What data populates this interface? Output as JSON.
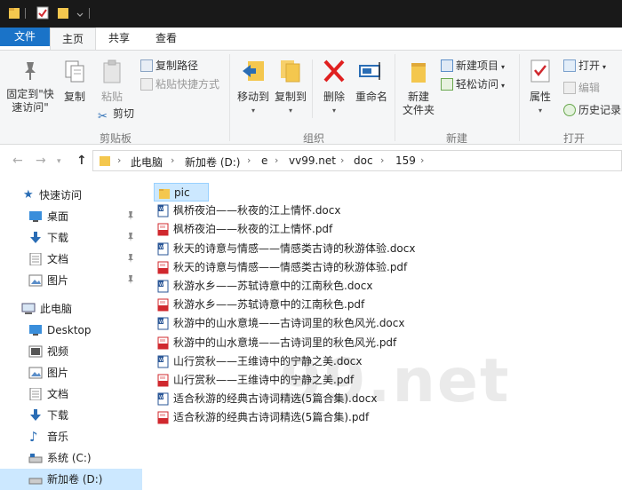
{
  "tabs": {
    "file": "文件",
    "home": "主页",
    "share": "共享",
    "view": "查看"
  },
  "ribbon": {
    "clipboard": {
      "group_label": "剪贴板",
      "pin_label_1": "固定到\"快",
      "pin_label_2": "速访问\"",
      "copy": "复制",
      "paste": "粘贴",
      "copy_path": "复制路径",
      "paste_shortcut": "粘贴快捷方式",
      "cut": "剪切"
    },
    "organize": {
      "group_label": "组织",
      "move_to": "移动到",
      "copy_to": "复制到",
      "delete": "删除",
      "rename": "重命名"
    },
    "new": {
      "group_label": "新建",
      "new_folder_1": "新建",
      "new_folder_2": "文件夹",
      "new_item": "新建项目",
      "easy_access": "轻松访问"
    },
    "open": {
      "group_label": "打开",
      "properties": "属性",
      "open": "打开",
      "edit": "编辑",
      "history": "历史记录"
    }
  },
  "address": {
    "crumbs": [
      "此电脑",
      "新加卷 (D:)",
      "e",
      "vv99.net",
      "doc",
      "159"
    ]
  },
  "nav": {
    "quick_access": "快速访问",
    "desktop_quick": "桌面",
    "downloads_quick": "下载",
    "documents_quick": "文档",
    "pictures_quick": "图片",
    "this_pc": "此电脑",
    "desktop": "Desktop",
    "videos": "视频",
    "pictures": "图片",
    "documents": "文档",
    "downloads": "下载",
    "music": "音乐",
    "system_c": "系统 (C:)",
    "new_vol_d": "新加卷 (D:)"
  },
  "files": [
    {
      "name": "pic",
      "type": "folder"
    },
    {
      "name": "枫桥夜泊——秋夜的江上情怀.docx",
      "type": "docx"
    },
    {
      "name": "枫桥夜泊——秋夜的江上情怀.pdf",
      "type": "pdf"
    },
    {
      "name": "秋天的诗意与情感——情感类古诗的秋游体验.docx",
      "type": "docx"
    },
    {
      "name": "秋天的诗意与情感——情感类古诗的秋游体验.pdf",
      "type": "pdf"
    },
    {
      "name": "秋游水乡——苏轼诗意中的江南秋色.docx",
      "type": "docx"
    },
    {
      "name": "秋游水乡——苏轼诗意中的江南秋色.pdf",
      "type": "pdf"
    },
    {
      "name": "秋游中的山水意境——古诗词里的秋色风光.docx",
      "type": "docx"
    },
    {
      "name": "秋游中的山水意境——古诗词里的秋色风光.pdf",
      "type": "pdf"
    },
    {
      "name": "山行赏秋——王维诗中的宁静之美.docx",
      "type": "docx"
    },
    {
      "name": "山行赏秋——王维诗中的宁静之美.pdf",
      "type": "pdf"
    },
    {
      "name": "适合秋游的经典古诗词精选(5篇合集).docx",
      "type": "docx"
    },
    {
      "name": "适合秋游的经典古诗词精选(5篇合集).pdf",
      "type": "pdf"
    }
  ],
  "watermark": "99.net",
  "colors": {
    "accent": "#1a73c8",
    "selection": "#cce8ff",
    "folder": "#f4c74e",
    "word": "#2b5797",
    "pdf": "#d0282e",
    "delete": "#e02020"
  }
}
